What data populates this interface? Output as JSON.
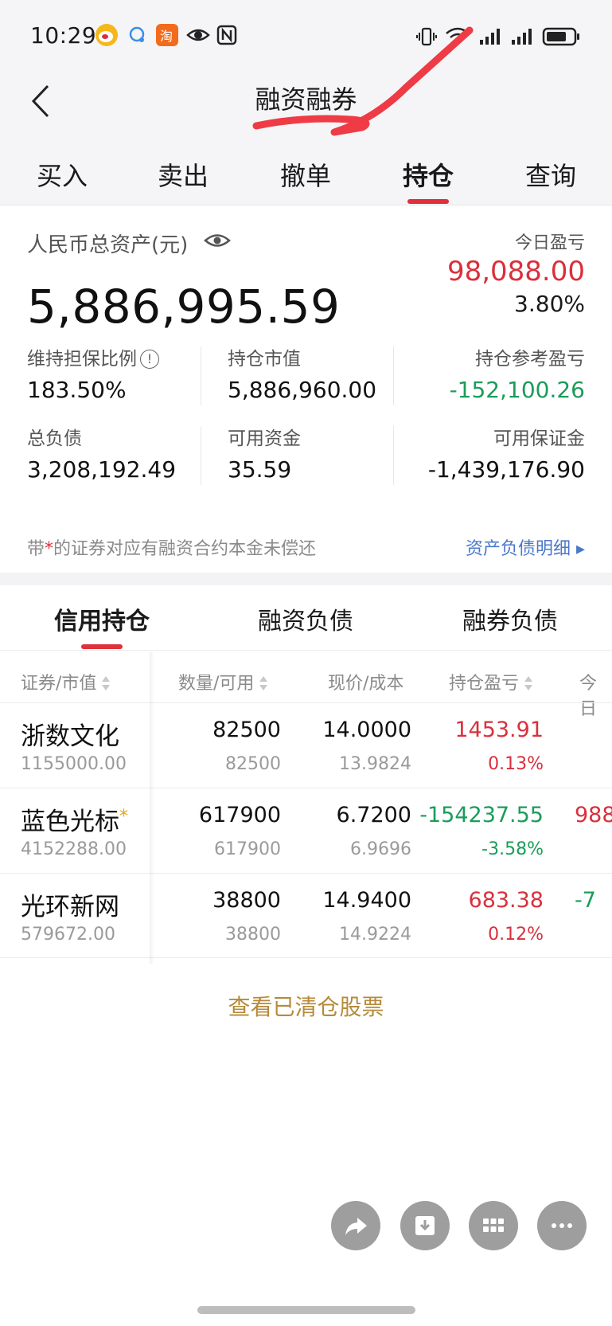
{
  "status_bar": {
    "time": "10:29"
  },
  "header": {
    "title": "融资融券"
  },
  "tabs": [
    {
      "label": "买入"
    },
    {
      "label": "卖出"
    },
    {
      "label": "撤单"
    },
    {
      "label": "持仓",
      "active": true
    },
    {
      "label": "查询"
    }
  ],
  "summary": {
    "total_assets_label": "人民币总资产(元)",
    "total_assets_value": "5,886,995.59",
    "today_pl_label": "今日盈亏",
    "today_pl_value": "98,088.00",
    "today_pl_pct": "3.80%",
    "grid": {
      "maintenance_ratio_label": "维持担保比例",
      "maintenance_ratio_value": "183.50%",
      "position_mv_label": "持仓市值",
      "position_mv_value": "5,886,960.00",
      "position_ref_pl_label": "持仓参考盈亏",
      "position_ref_pl_value": "-152,100.26",
      "total_liab_label": "总负债",
      "total_liab_value": "3,208,192.49",
      "available_funds_label": "可用资金",
      "available_funds_value": "35.59",
      "available_margin_label": "可用保证金",
      "available_margin_value": "-1,439,176.90"
    },
    "note_prefix": "带",
    "note_star": "*",
    "note_suffix": "的证券对应有融资合约本金未偿还",
    "detail_link": "资产负债明细 ▸"
  },
  "sub_tabs": [
    {
      "label": "信用持仓",
      "active": true
    },
    {
      "label": "融资负债"
    },
    {
      "label": "融券负债"
    }
  ],
  "table": {
    "headers": {
      "security": "证券/市值",
      "qty": "数量/可用",
      "price": "现价/成本",
      "pl": "持仓盈亏",
      "today": "今日"
    },
    "rows": [
      {
        "name": "浙数文化",
        "star": "",
        "market_value": "1155000.00",
        "qty": "82500",
        "avail": "82500",
        "price": "14.0000",
        "cost": "13.9824",
        "pl": "1453.91",
        "pl_pct": "0.13%",
        "today": ""
      },
      {
        "name": "蓝色光标",
        "star": "*",
        "market_value": "4152288.00",
        "qty": "617900",
        "avail": "617900",
        "price": "6.7200",
        "cost": "6.9696",
        "pl": "-154237.55",
        "pl_pct": "-3.58%",
        "today": "988"
      },
      {
        "name": "光环新网",
        "star": "",
        "market_value": "579672.00",
        "qty": "38800",
        "avail": "38800",
        "price": "14.9400",
        "cost": "14.9224",
        "pl": "683.38",
        "pl_pct": "0.12%",
        "today": "-7"
      }
    ]
  },
  "view_cleared_label": "查看已清仓股票",
  "colors": {
    "up_red": "#d9303c",
    "down_green": "#1b9c5a",
    "accent_red": "#e0303a",
    "link_blue": "#4a78c8",
    "gold": "#b68a3a"
  },
  "icons": [
    "weibo-icon",
    "message-icon",
    "taobao-icon",
    "eye-icon",
    "nfc-icon",
    "vibrate-icon",
    "wifi-icon",
    "signal-icon",
    "battery-icon",
    "back-icon",
    "info-icon",
    "sort-icon",
    "share-icon",
    "download-icon",
    "grid-icon",
    "more-icon"
  ]
}
